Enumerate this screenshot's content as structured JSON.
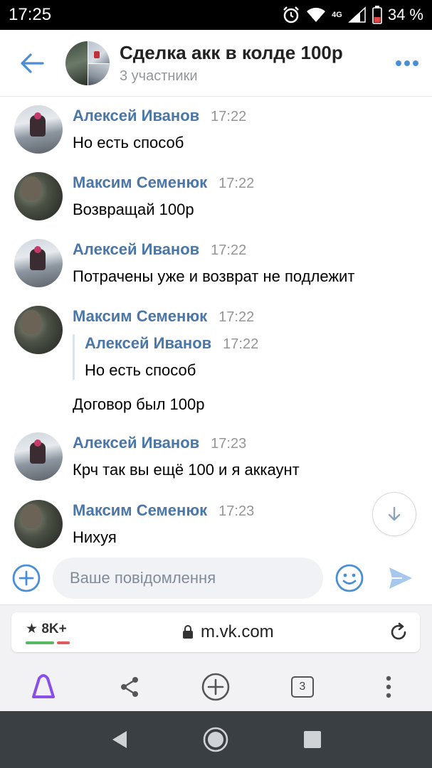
{
  "status_bar": {
    "time": "17:25",
    "network": "4G",
    "battery": "34 %"
  },
  "header": {
    "title": "Сделка акк в колде 100р",
    "subtitle": "3 участники"
  },
  "messages": [
    {
      "author": "Алексей Иванов",
      "time": "17:22",
      "text": "Но есть способ",
      "avatar": "alexey"
    },
    {
      "author": "Максим Семенюк",
      "time": "17:22",
      "text": "Возвращай 100р",
      "avatar": "maxim"
    },
    {
      "author": "Алексей Иванов",
      "time": "17:22",
      "text": "Потрачены уже и возврат не подлежит",
      "avatar": "alexey"
    },
    {
      "author": "Максим Семенюк",
      "time": "17:22",
      "text": "Договор был 100р",
      "avatar": "maxim",
      "quote": {
        "author": "Алексей Иванов",
        "time": "17:22",
        "text": "Но есть способ"
      }
    },
    {
      "author": "Алексей Иванов",
      "time": "17:23",
      "text": "Крч так вы ещё 100 и я аккаунт",
      "avatar": "alexey"
    },
    {
      "author": "Максим Семенюк",
      "time": "17:23",
      "text": "Нихуя",
      "avatar": "maxim"
    }
  ],
  "composer": {
    "placeholder": "Ваше повідомлення"
  },
  "browser": {
    "rating": "8K+",
    "url": "m.vk.com",
    "tabs_count": "3"
  },
  "colors": {
    "accent": "#4a76a8",
    "send": "#a7c7ec"
  }
}
